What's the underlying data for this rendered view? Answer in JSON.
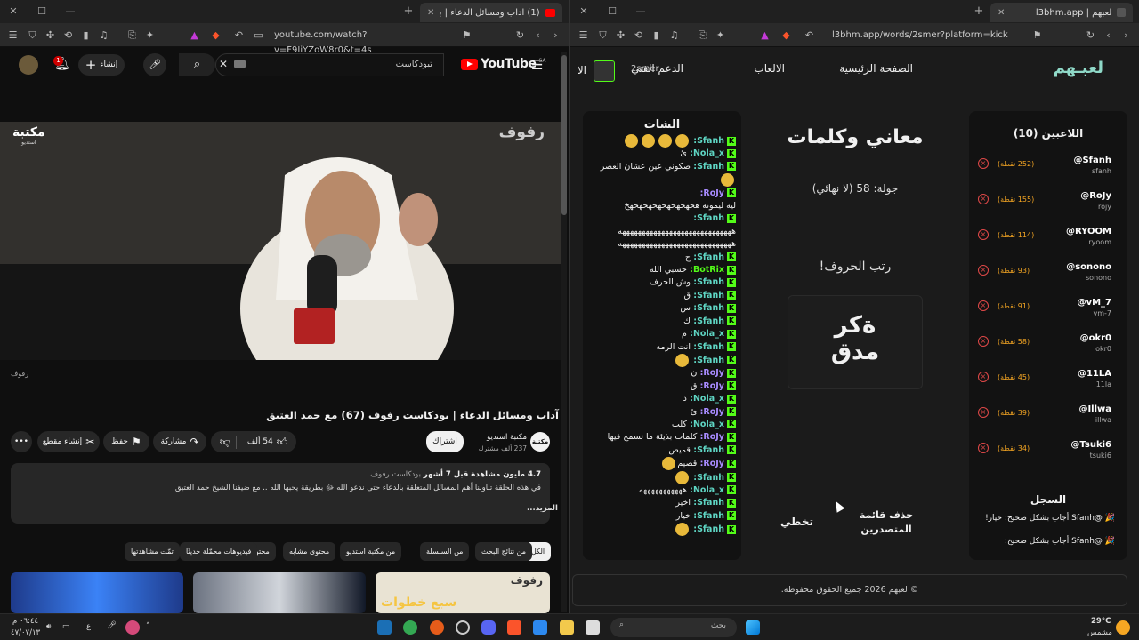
{
  "left_window": {
    "tab_title": "(1) آداب ومسائل الدعاء | بودكا...",
    "url": "youtube.com/watch?v=F9IiYZoW8r0&t=4s",
    "youtube": {
      "logo_text": "YouTube",
      "region_badge": "SA",
      "search_value": "تبودكاست",
      "create_label": "إنشاء",
      "notification_count": "1"
    },
    "video": {
      "watermark_left": "مكتبة",
      "watermark_left_sub": "استديو",
      "watermark_right": "رفوف",
      "bottom_mark": "رفوف"
    },
    "title": "آداب ومسائل الدعاء | بودكاست رفوف (67) مع حمد العتيق",
    "channel": {
      "name": "مكتبة استديو",
      "subscribers": "237 ألف مشترك",
      "subscribe_label": "اشتراك"
    },
    "actions": {
      "likes": "54 ألف",
      "share": "مشاركة",
      "save": "حفظ",
      "clip": "إنشاء مقطع"
    },
    "description": {
      "stats": "4.7 مليون مشاهدة  قبل 7 أشهر",
      "tag": "بودكاست رفوف",
      "text": "في هذه الحلقة تناولنا أهم المسائل المتعلقة بالدعاء حتى ندعو الله ﷻ بطريقة يحبها الله .. مع ضيفنا الشيخ حمد العتيق",
      "more": "...المزيد"
    },
    "chips": [
      "الكل",
      "من نتائج البحث",
      "من السلسلة",
      "من مكتبة استديو",
      "محتوى مشابه",
      "محتوى بهيئة",
      "فيديوهات محمّلة حديثًا",
      "تمّت مشاهدتها"
    ],
    "thumb_text": "سبع خطوات",
    "thumb_label": "رفوف"
  },
  "right_window": {
    "tab_title": "لعبهم | l3bhm.app",
    "url": "l3bhm.app/words/2smer?platform=kick",
    "site": {
      "logo": "لعبـهم",
      "nav": [
        "الصفحة الرئيسية",
        "الالعاب",
        "الدعم الفني"
      ],
      "nav_cut": "الا",
      "user": "2smer"
    },
    "chat": {
      "title": "الشات",
      "messages": [
        {
          "user": "Sfanh:",
          "text": "",
          "emojis": 4,
          "color": "t"
        },
        {
          "user": "Nola_x:",
          "text": "ئ",
          "emojis": 0,
          "color": "t"
        },
        {
          "user": "Sfanh:",
          "text": "صكوني عين عشان العصر",
          "emojis": 0,
          "color": "t"
        },
        {
          "user": "",
          "text": "",
          "emojis": 1,
          "color": "t"
        },
        {
          "user": "RoJy:",
          "text": "",
          "emojis": 0,
          "color": "p"
        },
        {
          "user": "",
          "text": "ليه ليمونة هخهخهخهخهخهخهخهخ",
          "emojis": 0,
          "color": "t"
        },
        {
          "user": "Sfanh:",
          "text": "",
          "emojis": 0,
          "color": "t"
        },
        {
          "user": "",
          "text": "هههههههههههههههههههههههههههههه",
          "emojis": 0,
          "color": "t"
        },
        {
          "user": "",
          "text": "هههههههههههههههههههههههههههههه",
          "emojis": 0,
          "color": "t"
        },
        {
          "user": "Sfanh:",
          "text": "ح",
          "emojis": 0,
          "color": "t"
        },
        {
          "user": "BotRix:",
          "text": "حسبي الله",
          "emojis": 0,
          "color": "g"
        },
        {
          "user": "Sfanh:",
          "text": "وش الحرف",
          "emojis": 0,
          "color": "t"
        },
        {
          "user": "Sfanh:",
          "text": "ق",
          "emojis": 0,
          "color": "t"
        },
        {
          "user": "Sfanh:",
          "text": "س",
          "emojis": 0,
          "color": "t"
        },
        {
          "user": "Sfanh:",
          "text": "ك",
          "emojis": 0,
          "color": "t"
        },
        {
          "user": "Nola_x:",
          "text": "م",
          "emojis": 0,
          "color": "t"
        },
        {
          "user": "Sfanh:",
          "text": "انت الرمه",
          "emojis": 0,
          "color": "t"
        },
        {
          "user": "Sfanh:",
          "text": "",
          "emojis": 1,
          "color": "t"
        },
        {
          "user": "RoJy:",
          "text": "ن",
          "emojis": 0,
          "color": "p"
        },
        {
          "user": "RoJy:",
          "text": "ق",
          "emojis": 0,
          "color": "p"
        },
        {
          "user": "Nola_x:",
          "text": "د",
          "emojis": 0,
          "color": "t"
        },
        {
          "user": "RoJy:",
          "text": "ئ",
          "emojis": 0,
          "color": "p"
        },
        {
          "user": "Nola_x:",
          "text": "كلب",
          "emojis": 0,
          "color": "t"
        },
        {
          "user": "RoJy:",
          "text": "كلمات بذيئة ما نسمح فيها",
          "emojis": 0,
          "color": "p"
        },
        {
          "user": "Sfanh:",
          "text": "قميص",
          "emojis": 0,
          "color": "t"
        },
        {
          "user": "RoJy:",
          "text": "قصيم",
          "emojis": 1,
          "color": "p"
        },
        {
          "user": "Sfanh:",
          "text": "",
          "emojis": 1,
          "color": "t"
        },
        {
          "user": "Nola_x:",
          "text": "هههههههههههه",
          "emojis": 0,
          "color": "t"
        },
        {
          "user": "Sfanh:",
          "text": "اخير",
          "emojis": 0,
          "color": "t"
        },
        {
          "user": "Sfanh:",
          "text": "خيار",
          "emojis": 0,
          "color": "t"
        },
        {
          "user": "Sfanh:",
          "text": "",
          "emojis": 1,
          "color": "t"
        }
      ]
    },
    "game": {
      "title": "معاني وكلمات",
      "round": "جولة: 58 (لا نهائي)",
      "prompt": "رتب الحروف!",
      "scramble_line1": "ةكر",
      "scramble_line2": "مدق",
      "skip": "تخطي",
      "clear_leaders": "حذف قائمة المتصدرين"
    },
    "players": {
      "title": "اللاعبين (10)",
      "list": [
        {
          "name": "@Sfanh",
          "handle": "sfanh",
          "points": "(252 نقطة)"
        },
        {
          "name": "@RoJy",
          "handle": "rojy",
          "points": "(155 نقطة)"
        },
        {
          "name": "@RYOOM",
          "handle": "ryoom",
          "points": "(114 نقطة)"
        },
        {
          "name": "@sonono",
          "handle": "sonono",
          "points": "(93 نقطة)"
        },
        {
          "name": "@vM_7",
          "handle": "vm-7",
          "points": "(91 نقطة)"
        },
        {
          "name": "@okr0",
          "handle": "okr0",
          "points": "(58 نقطة)"
        },
        {
          "name": "@11LA",
          "handle": "11la",
          "points": "(45 نقطة)"
        },
        {
          "name": "@Illwa",
          "handle": "illwa",
          "points": "(39 نقطة)"
        },
        {
          "name": "@Tsuki6",
          "handle": "tsuki6",
          "points": "(34 نقطة)"
        }
      ]
    },
    "log": {
      "title": "السجل",
      "entries": [
        "🎉 @Sfanh أجاب بشكل صحيح: خيار!",
        "🎉 @Sfanh أجاب بشكل صحيح:"
      ]
    },
    "footer": "© لعبهم 2026 جميع الحقوق محفوظة."
  },
  "taskbar": {
    "time": "٠٦:٤٤ م",
    "date": "٤٧/٠٧/١٣",
    "lang": "ع",
    "search_placeholder": "بحث",
    "weather_temp": "29°C",
    "weather_desc": "مشمس"
  },
  "colors": {
    "kick_green": "#53fc18",
    "youtube_red": "#ff0000",
    "points_orange": "#f5a623",
    "remove_red": "#e04848"
  }
}
